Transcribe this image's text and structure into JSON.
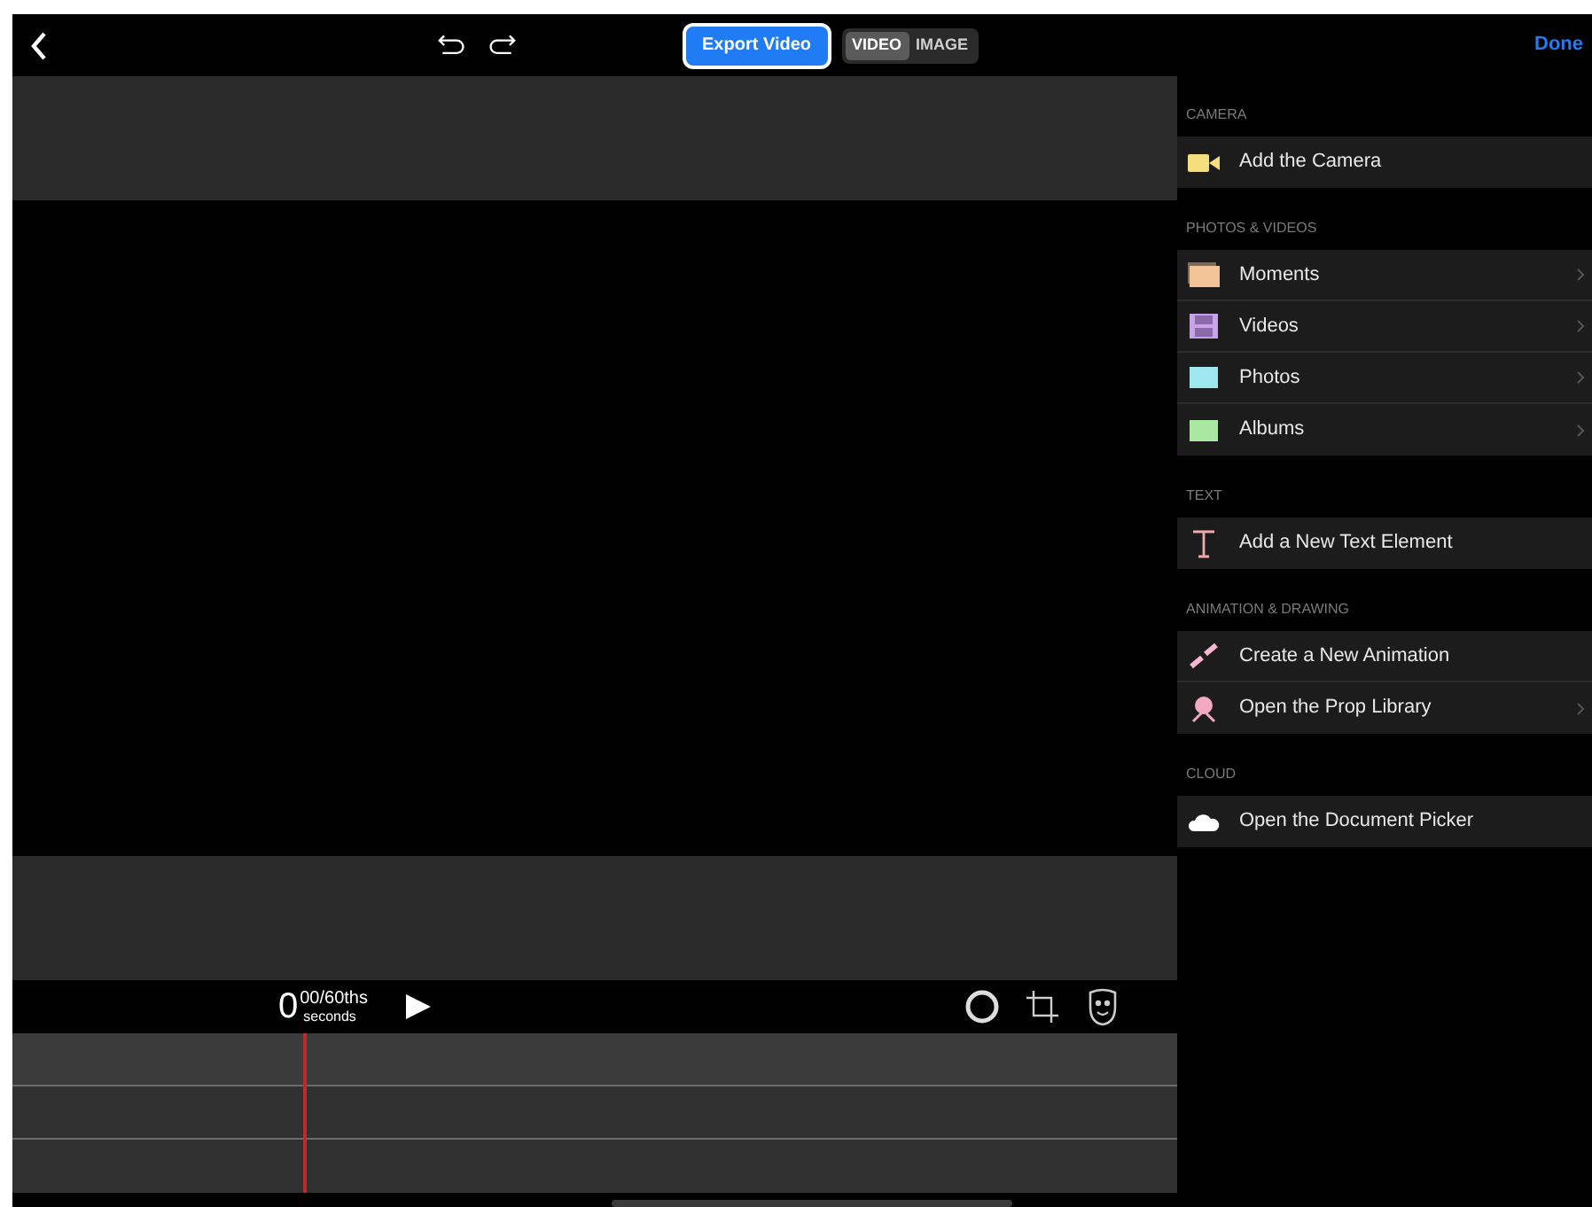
{
  "toolbar": {
    "export_button": "Export Video",
    "modes": [
      {
        "label": "VIDEO",
        "selected": true
      },
      {
        "label": "IMAGE",
        "selected": false
      }
    ]
  },
  "timeline": {
    "time_whole": "0",
    "time_fraction": "00/60ths",
    "time_unit": "seconds"
  },
  "panel": {
    "done_button": "Done",
    "sections": [
      {
        "title": "CAMERA",
        "items": [
          {
            "kind": "camera",
            "label": "Add the Camera",
            "chevron": false
          }
        ]
      },
      {
        "title": "PHOTOS & VIDEOS",
        "items": [
          {
            "kind": "moments",
            "label": "Moments",
            "chevron": true
          },
          {
            "kind": "videos",
            "label": "Videos",
            "chevron": true
          },
          {
            "kind": "photos",
            "label": "Photos",
            "chevron": true
          },
          {
            "kind": "albums",
            "label": "Albums",
            "chevron": true
          }
        ]
      },
      {
        "title": "TEXT",
        "items": [
          {
            "kind": "text",
            "label": "Add a New Text Element",
            "chevron": false
          }
        ]
      },
      {
        "title": "ANIMATION & DRAWING",
        "items": [
          {
            "kind": "brush",
            "label": "Create a New Animation",
            "chevron": false
          },
          {
            "kind": "prop",
            "label": "Open the Prop Library",
            "chevron": true
          }
        ]
      },
      {
        "title": "CLOUD",
        "items": [
          {
            "kind": "cloud",
            "label": "Open the Document Picker",
            "chevron": false
          }
        ]
      }
    ]
  }
}
